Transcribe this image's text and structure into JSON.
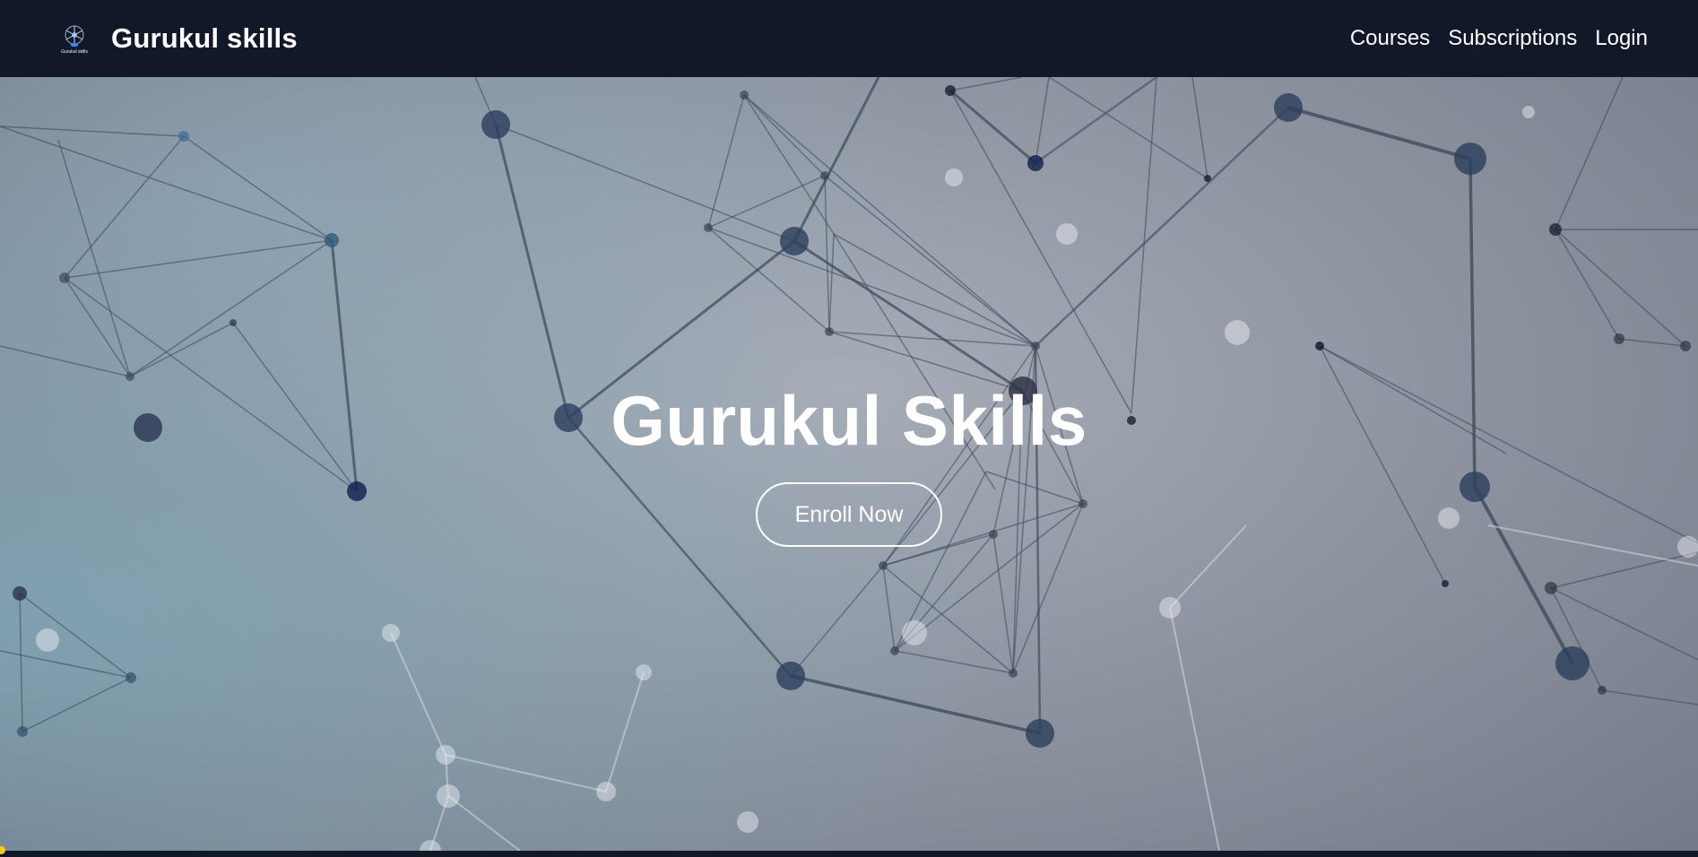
{
  "navbar": {
    "brand": {
      "logo_caption": "Gurukul skills",
      "name": "Gurukul skills"
    },
    "links": [
      {
        "label": "Courses"
      },
      {
        "label": "Subscriptions"
      },
      {
        "label": "Login"
      }
    ]
  },
  "hero": {
    "title": "Gurukul Skills",
    "cta_label": "Enroll Now",
    "background": "network-constellation"
  },
  "colors": {
    "navbar_bg": "#111827",
    "text": "#ffffff",
    "hero_bg": "#9299a4",
    "node": "#2c3e5c",
    "accent_dot": "#facc15"
  }
}
